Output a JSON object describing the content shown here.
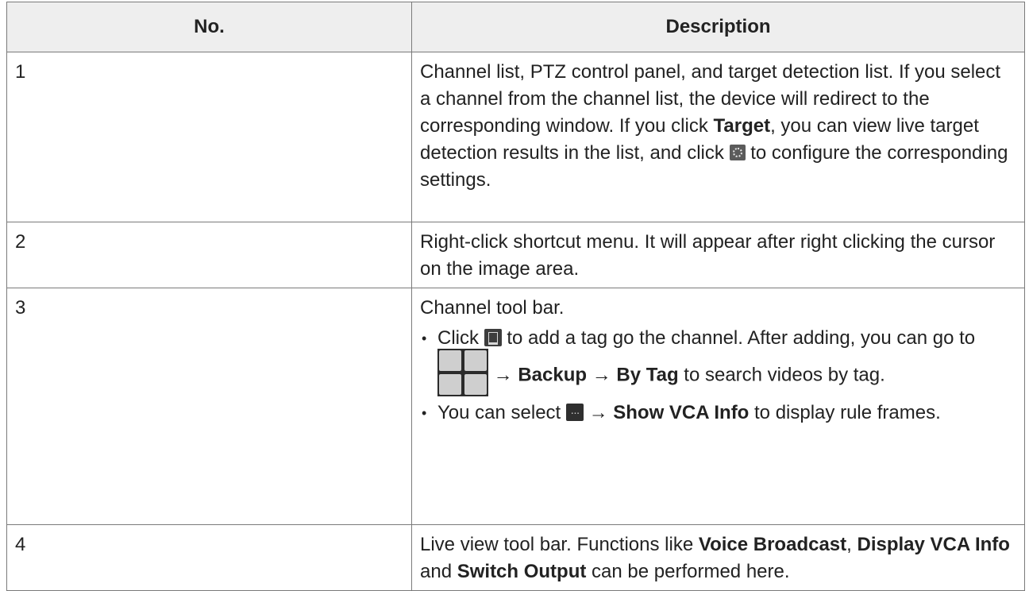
{
  "table": {
    "headers": [
      "No.",
      "Description"
    ],
    "rows": [
      {
        "no": "1",
        "desc": {
          "part1": "Channel list, PTZ control panel, and target detection list. If you select a channel from the channel list, the device will redirect to the corresponding window. If you click ",
          "target": "Target",
          "part2": ", you can view live target detection results in the list, and click ",
          "part3": " to configure the corresponding settings.",
          "icon": "settings-gear-icon"
        }
      },
      {
        "no": "2",
        "desc": {
          "text": "Right-click shortcut menu. It will appear after right clicking the cursor on the image area."
        }
      },
      {
        "no": "3",
        "desc": {
          "intro": "Channel tool bar.",
          "b1_click": "Click ",
          "b1_mid": " to add a tag go the channel. After adding, you can go to ",
          "b1_arrow1": " → ",
          "b1_backup": "Backup",
          "b1_arrow2": " → ",
          "b1_bytag": "By Tag",
          "b1_end": " to search videos by tag.",
          "b2_start": "You can select ",
          "b2_arrow": " → ",
          "b2_show": "Show VCA Info",
          "b2_end": " to display rule frames.",
          "icons": [
            "tag-icon",
            "main-menu-grid-icon",
            "more-icon"
          ]
        }
      },
      {
        "no": "4",
        "desc": {
          "p1": "Live view tool bar. Functions like ",
          "voice": "Voice Broadcast",
          "comma": ", ",
          "display": "Display VCA Info",
          "and": " and ",
          "switch": "Switch Output",
          "p2": " can be performed here."
        }
      }
    ]
  }
}
